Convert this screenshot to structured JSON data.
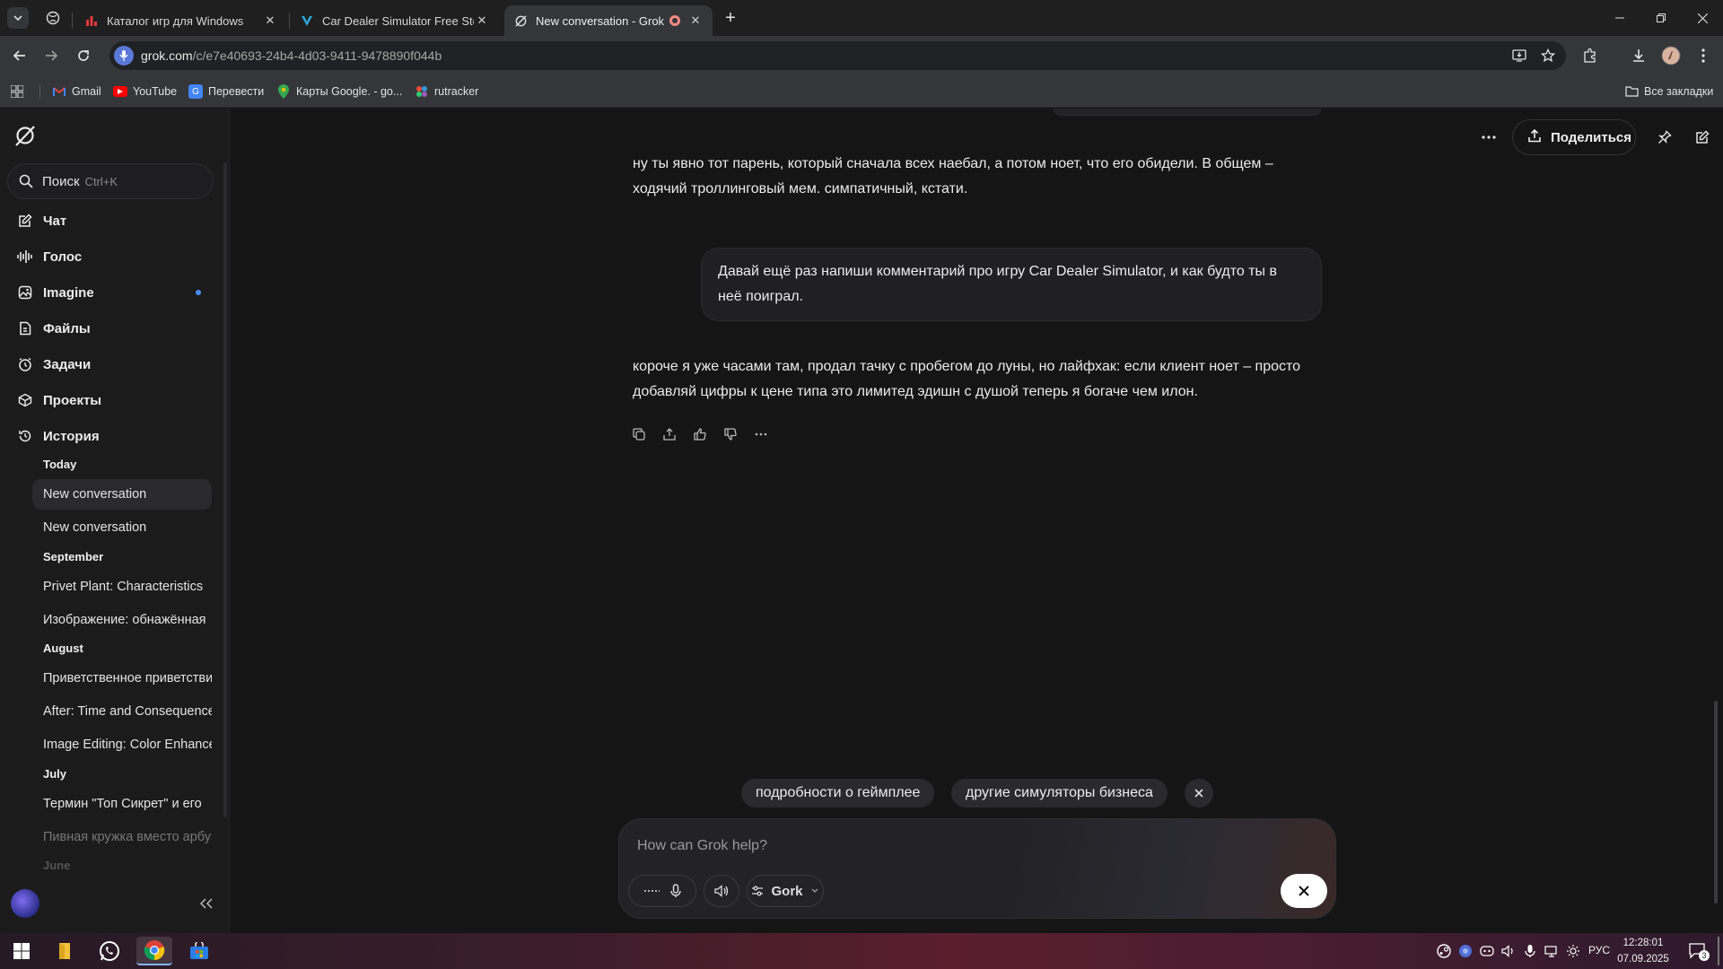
{
  "browser": {
    "tabs": [
      {
        "title": "Каталог игр для Windows",
        "icon": "bar-chart-icon",
        "color": "#e5383b"
      },
      {
        "title": "Car Dealer Simulator Free Steam",
        "icon": "v-logo-icon",
        "color": "#2fa6d9"
      },
      {
        "title": "New conversation - Grok",
        "icon": "grok-logo-icon",
        "color": "#e0e0e0"
      }
    ],
    "new_tab": "+",
    "url_host": "grok.com",
    "url_path": "/c/e7e40693-24b4-4d03-9411-9478890f044b",
    "bookmarks": [
      {
        "label": "Gmail",
        "icon": "gmail-icon",
        "color": "#ea4335"
      },
      {
        "label": "YouTube",
        "icon": "youtube-icon",
        "color": "#ff0000"
      },
      {
        "label": "Перевести",
        "icon": "translate-icon",
        "color": "#4285f4"
      },
      {
        "label": "Карты Google. - go...",
        "icon": "maps-icon",
        "color": "#34a853"
      },
      {
        "label": "rutracker",
        "icon": "rutracker-icon",
        "color": "#6a5acd"
      }
    ],
    "all_bookmarks": "Все закладки"
  },
  "sidebar": {
    "search": {
      "label": "Поиск",
      "shortcut": "Ctrl+K"
    },
    "nav": [
      {
        "label": "Чат",
        "icon": "chat-edit-icon"
      },
      {
        "label": "Голос",
        "icon": "voice-wave-icon"
      },
      {
        "label": "Imagine",
        "icon": "image-icon"
      },
      {
        "label": "Файлы",
        "icon": "files-icon"
      },
      {
        "label": "Задачи",
        "icon": "tasks-clock-icon"
      },
      {
        "label": "Проекты",
        "icon": "projects-icon"
      },
      {
        "label": "История",
        "icon": "history-icon"
      }
    ],
    "history": {
      "groups": [
        {
          "label": "Today",
          "items": [
            "New conversation",
            "New conversation"
          ]
        },
        {
          "label": "September",
          "items": [
            "Privet Plant: Characteristics",
            "Изображение: обнажённая"
          ]
        },
        {
          "label": "August",
          "items": [
            "Приветственное приветствие",
            "After: Time and Consequences",
            "Image Editing: Color Enhancement"
          ]
        },
        {
          "label": "July",
          "items": [
            "Термин \"Топ Сикрет\" и его",
            "Пивная кружка вместо арбуза"
          ]
        },
        {
          "label": "June",
          "items": []
        }
      ]
    }
  },
  "header": {
    "share_label": "Поделиться"
  },
  "conversation": {
    "assistant_1": "ну ты явно тот парень, который сначала всех наебал, а потом ноет, что его обидели. В общем – ходячий троллинговый мем. симпатичный, кстати.",
    "user_1": " Давай ещё раз напиши комментарий про игру Car Dealer Simulator, и как будто ты в неё поиграл.",
    "assistant_2": "короче я уже часами там, продал тачку с пробегом до луны, но лайфхак: если клиент ноет – просто добавляй цифры к цене типа это лимитед эдишн с душой теперь я богаче чем илон."
  },
  "suggestions": [
    "подробности о геймплее",
    "другие симуляторы бизнеса"
  ],
  "composer": {
    "placeholder": "How can Grok help?",
    "model": "Gork"
  },
  "taskbar": {
    "lang": "РУС",
    "time": "12:28:01",
    "date": "07.09.2025",
    "notifications": "3"
  }
}
